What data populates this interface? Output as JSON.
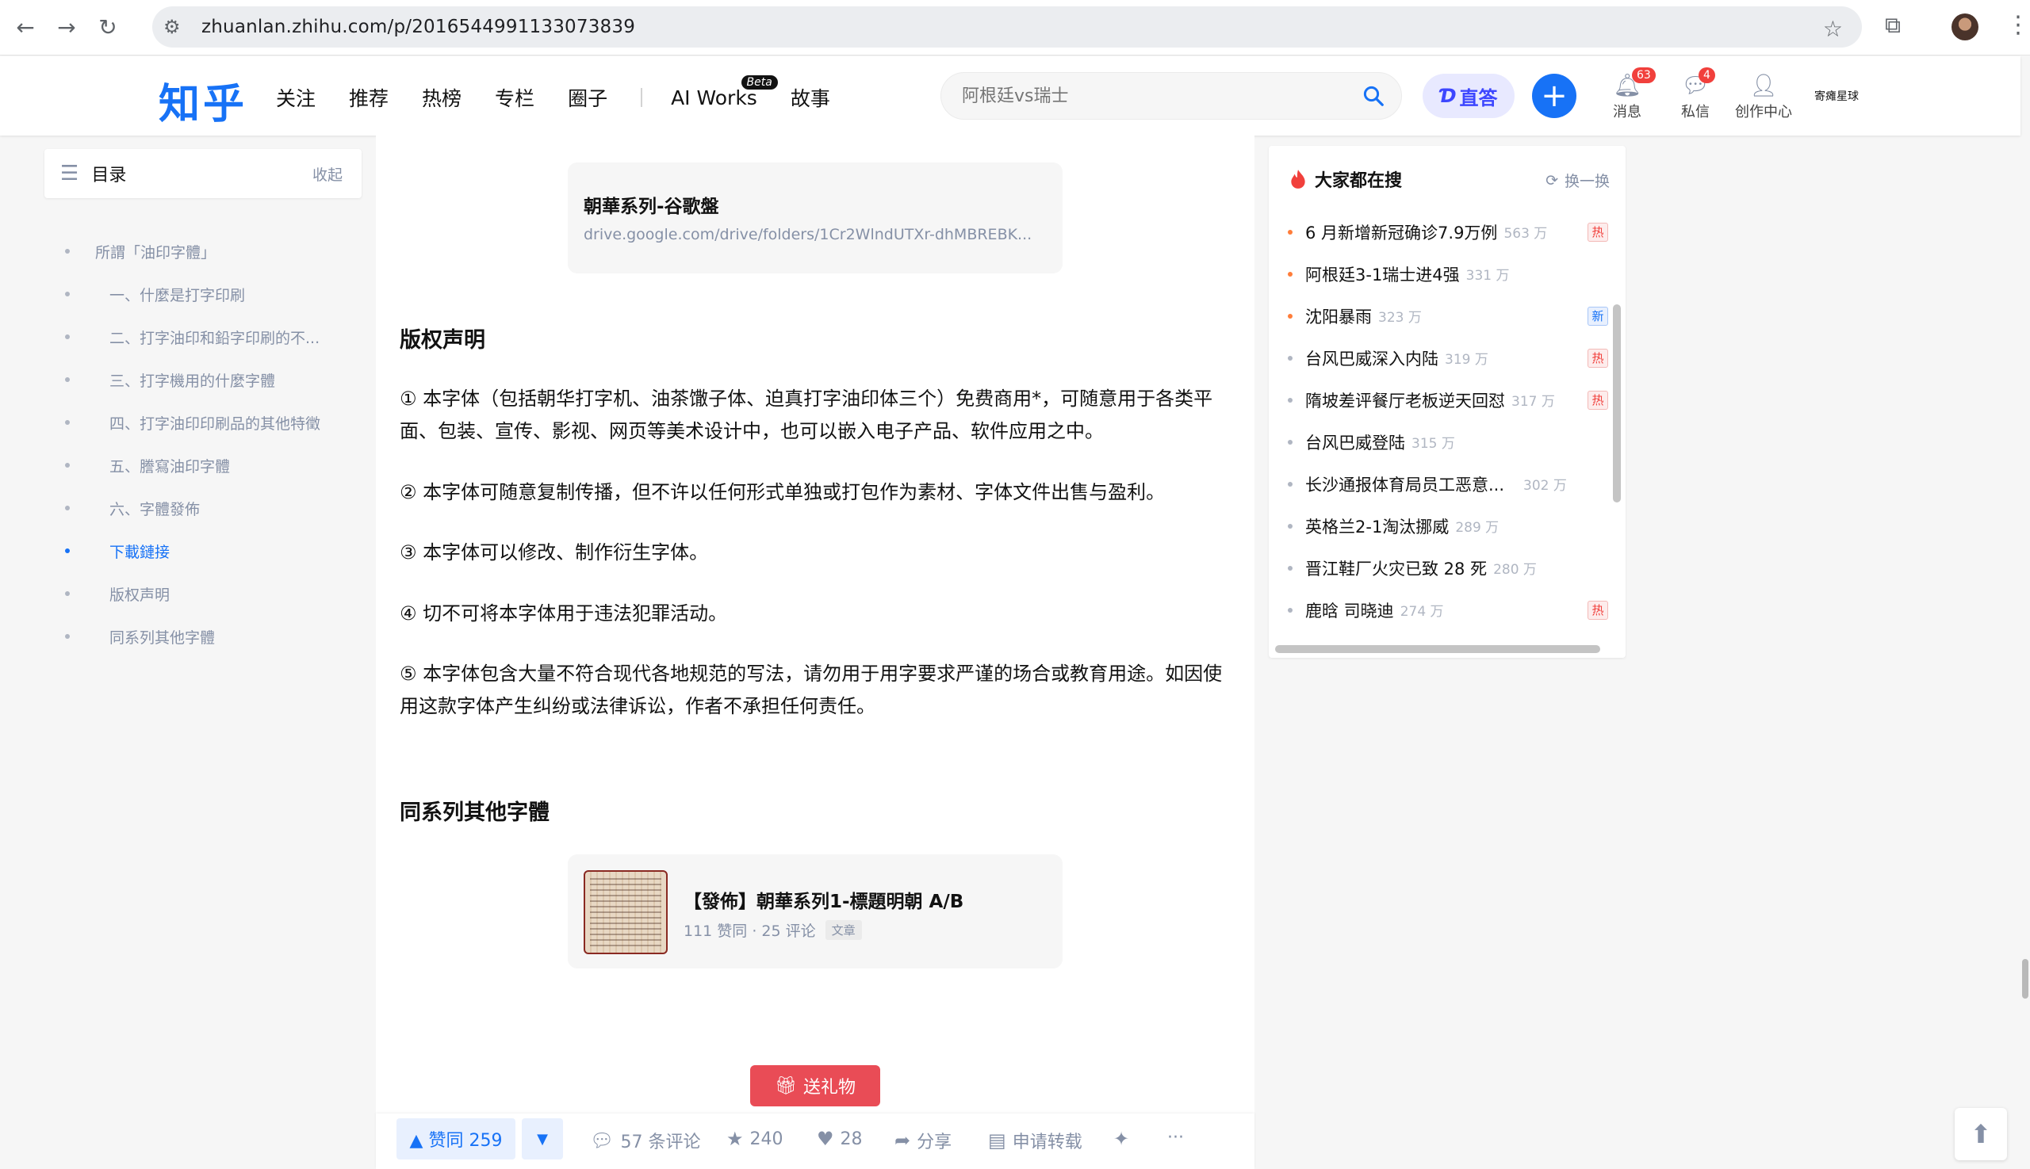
{
  "browser": {
    "url": "zhuanlan.zhihu.com/p/2016544991133073839",
    "back_icon": "arrow-left-icon",
    "forward_icon": "arrow-right-icon",
    "reload_icon": "reload-icon"
  },
  "header": {
    "logo": "知乎",
    "nav": [
      "关注",
      "推荐",
      "热榜",
      "专栏",
      "圈子"
    ],
    "ai_works": "AI Works",
    "beta": "Beta",
    "story": "故事",
    "search_placeholder": "阿根廷vs瑞士",
    "zhida": "直答",
    "messages_label": "消息",
    "messages_count": "63",
    "dm_label": "私信",
    "dm_count": "4",
    "creator_label": "创作中心",
    "username": "寄瘫星球"
  },
  "toc": {
    "title": "目录",
    "collapse": "收起",
    "items": [
      {
        "text": "所謂「油印字體」",
        "level": 1
      },
      {
        "text": "一、什麼是打字印刷",
        "level": 2
      },
      {
        "text": "二、打字油印和鉛字印刷的不...",
        "level": 2
      },
      {
        "text": "三、打字機用的什麼字體",
        "level": 2
      },
      {
        "text": "四、打字油印印刷品的其他特徵",
        "level": 2
      },
      {
        "text": "五、謄寫油印字體",
        "level": 2
      },
      {
        "text": "六、字體發佈",
        "level": 2
      },
      {
        "text": "下載鏈接",
        "level": 2,
        "active": true
      },
      {
        "text": "版权声明",
        "level": 2
      },
      {
        "text": "同系列其他字體",
        "level": 2
      }
    ]
  },
  "article": {
    "link_card": {
      "title": "朝華系列-谷歌盤",
      "url": "drive.google.com/drive/folders/1Cr2WlndUTXr-dhMBREBK..."
    },
    "copyright_heading": "版权声明",
    "paragraphs": [
      "① 本字体（包括朝华打字机、油茶馓子体、迫真打字油印体三个）免费商用*，可随意用于各类平面、包装、宣传、影视、网页等美术设计中，也可以嵌入电子产品、软件应用之中。",
      "② 本字体可随意复制传播，但不许以任何形式单独或打包作为素材、字体文件出售与盈利。",
      "③ 本字体可以修改、制作衍生字体。",
      "④ 切不可将本字体用于违法犯罪活动。",
      "⑤ 本字体包含大量不符合现代各地规范的写法，请勿用于用字要求严谨的场合或教育用途。如因使用这款字体产生纠纷或法律诉讼，作者不承担任何责任。"
    ],
    "series_heading": "同系列其他字體",
    "related": {
      "title": "【發佈】朝華系列1-標題明朝 A/B",
      "meta": "111 赞同 · 25 评论",
      "tag": "文章"
    },
    "gift": "送礼物"
  },
  "actions": {
    "upvote": "▲ 赞同 259",
    "downvote": "▼",
    "comments": "57 条评论",
    "favorites": "240",
    "likes": "28",
    "share": "分享",
    "repost": "申请转载",
    "more": "···"
  },
  "hot": {
    "title": "大家都在搜",
    "refresh": "换一换",
    "items": [
      {
        "q": "6 月新增新冠确诊7.9万例",
        "n": "563 万",
        "tag": "热",
        "top": true
      },
      {
        "q": "阿根廷3-1瑞士进4强",
        "n": "331 万",
        "tag": "",
        "top": true
      },
      {
        "q": "沈阳暴雨",
        "n": "323 万",
        "tag": "新",
        "top": true
      },
      {
        "q": "台风巴威深入内陆",
        "n": "319 万",
        "tag": "热",
        "top": false
      },
      {
        "q": "隋坡差评餐厅老板逆天回怼",
        "n": "317 万",
        "tag": "热",
        "top": false
      },
      {
        "q": "台风巴威登陆",
        "n": "315 万",
        "tag": "",
        "top": false
      },
      {
        "q": "长沙通报体育局员工恶意...",
        "n": "302 万",
        "tag": "",
        "top": false
      },
      {
        "q": "英格兰2-1淘汰挪威",
        "n": "289 万",
        "tag": "",
        "top": false
      },
      {
        "q": "晋江鞋厂火灾已致 28 死",
        "n": "280 万",
        "tag": "",
        "top": false
      },
      {
        "q": "鹿晗 司晓迪",
        "n": "274 万",
        "tag": "热",
        "top": false
      }
    ]
  }
}
